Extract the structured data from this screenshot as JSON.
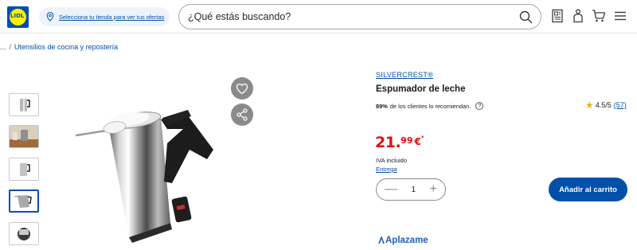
{
  "header": {
    "logo_text": "LIDL",
    "store_prompt": "Selecciona tu tienda para ver tus ofertas",
    "search_placeholder": "¿Qué estás buscando?"
  },
  "breadcrumb": {
    "ellipsis": "...",
    "separator": "/",
    "item": "Utensilios de cocina y repostería"
  },
  "product": {
    "brand": "SILVERCREST®",
    "title": "Espumador de leche",
    "recommend_pct": "89%",
    "recommend_text": "de los clientes lo recomiendan.",
    "rating": "4.5/5",
    "rating_count": "(57)",
    "price_int": "21.",
    "price_dec": "99",
    "currency": "€",
    "price_mark": "*",
    "vat_text": "IVA incluido",
    "delivery_link": "Entrega",
    "quantity": "1",
    "add_to_cart": "Añadir al carrito",
    "financing_brand": "Aplazame"
  },
  "colors": {
    "brand_blue": "#0050aa",
    "price_red": "#e60a14",
    "lidl_yellow": "#fff000",
    "icon_grey": "#8a8a8a"
  },
  "icons": [
    "location-pin-icon",
    "search-icon",
    "brochure-icon",
    "account-icon",
    "cart-icon",
    "menu-icon",
    "heart-icon",
    "share-icon",
    "help-icon",
    "star-icon",
    "minus-icon",
    "plus-icon"
  ]
}
